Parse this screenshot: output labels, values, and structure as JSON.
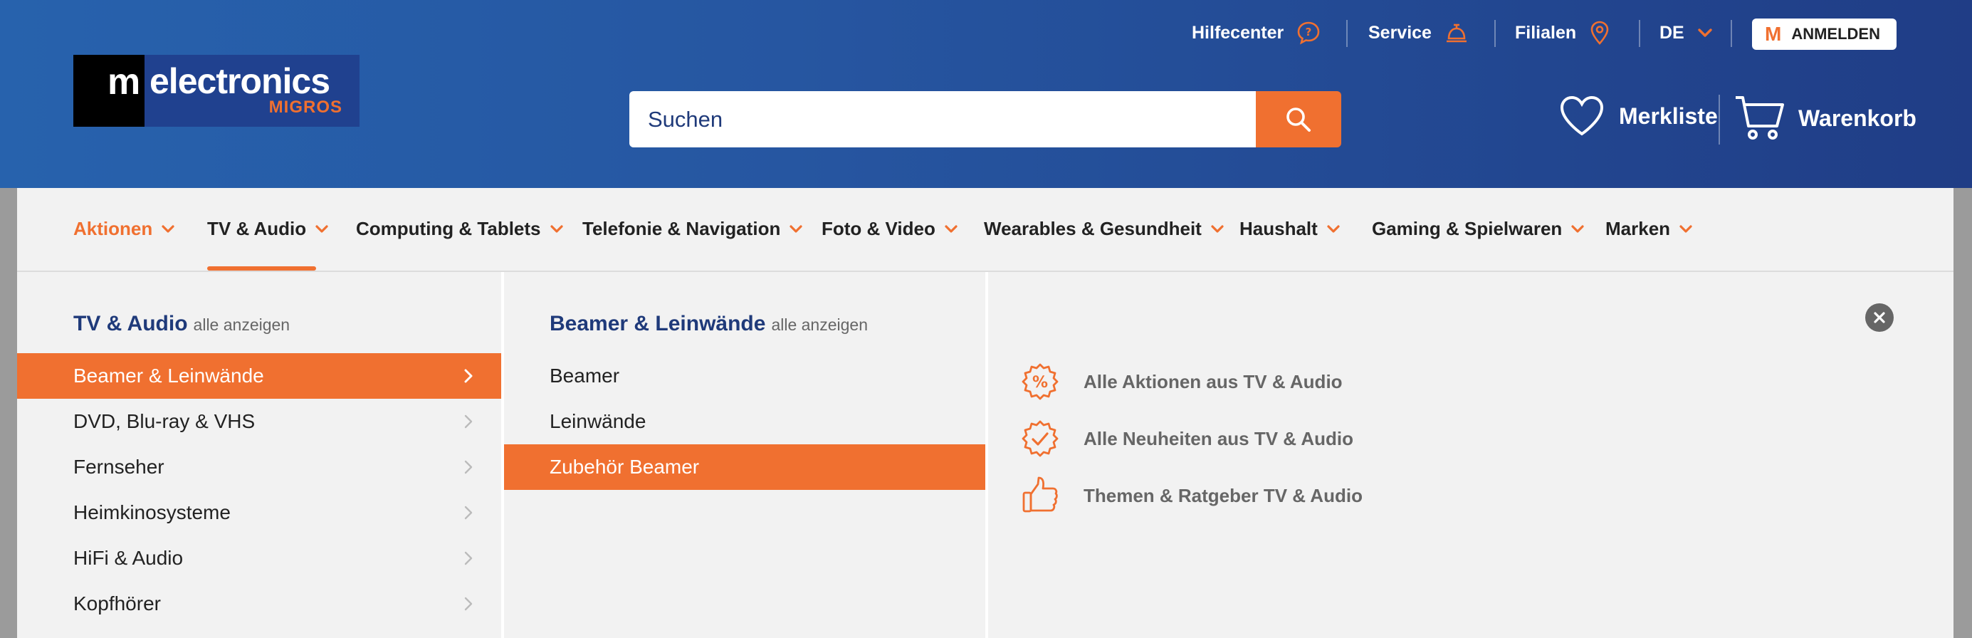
{
  "logo": {
    "m": "m",
    "brand": "electronics",
    "sub": "MIGROS"
  },
  "topnav": {
    "help": "Hilfecenter",
    "service": "Service",
    "stores": "Filialen",
    "language": "DE",
    "login_m": "M",
    "login": "ANMELDEN"
  },
  "search": {
    "placeholder": "Suchen"
  },
  "header_actions": {
    "wishlist": "Merkliste",
    "cart": "Warenkorb"
  },
  "categories": [
    "Aktionen",
    "TV & Audio",
    "Computing & Tablets",
    "Telefonie & Navigation",
    "Foto & Video",
    "Wearables & Gesundheit",
    "Haushalt",
    "Gaming & Spielwaren",
    "Marken"
  ],
  "col1": {
    "title": "TV & Audio",
    "all": "alle anzeigen",
    "items": [
      "Beamer & Leinwände",
      "DVD, Blu-ray & VHS",
      "Fernseher",
      "Heimkinosysteme",
      "HiFi & Audio",
      "Kopfhörer"
    ]
  },
  "col2": {
    "title": "Beamer & Leinwände",
    "all": "alle anzeigen",
    "items": [
      "Beamer",
      "Leinwände",
      "Zubehör Beamer"
    ]
  },
  "links": [
    "Alle Aktionen aus TV & Audio",
    "Alle Neuheiten aus TV & Audio",
    "Themen & Ratgeber TV & Audio"
  ],
  "colors": {
    "brand_blue": "#2656a1",
    "accent_orange": "#f07030",
    "panel_bg": "#f2f2f2"
  }
}
